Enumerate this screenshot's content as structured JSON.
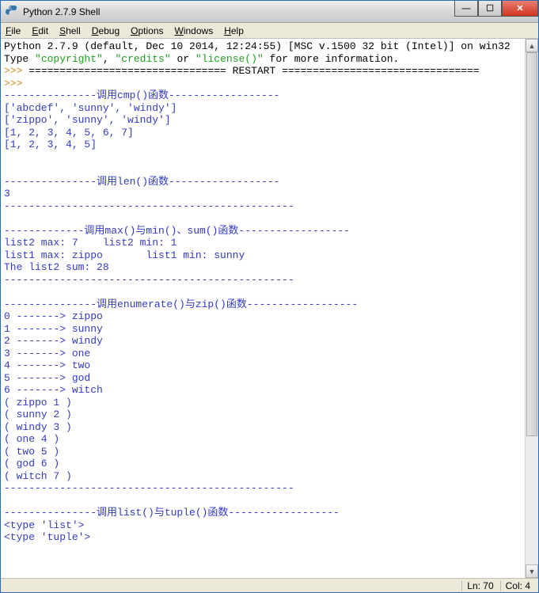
{
  "window": {
    "title": "Python 2.7.9 Shell"
  },
  "menu": {
    "file": "File",
    "edit": "Edit",
    "shell": "Shell",
    "debug": "Debug",
    "options": "Options",
    "windows": "Windows",
    "help": "Help"
  },
  "shell": {
    "version_line": "Python 2.7.9 (default, Dec 10 2014, 12:24:55) [MSC v.1500 32 bit (Intel)] on win32",
    "info_prefix": "Type ",
    "info_str1": "\"copyright\"",
    "info_sep1": ", ",
    "info_str2": "\"credits\"",
    "info_sep2": " or ",
    "info_str3": "\"license()\"",
    "info_suffix": " for more information.",
    "prompt1": ">>> ",
    "restart_line": "================================ RESTART ================================",
    "prompt2": ">>> ",
    "sec_cmp": "---------------调用cmp()函数------------------",
    "sec_cmp_l1": "['abcdef', 'sunny', 'windy']",
    "sec_cmp_l2": "['zippo', 'sunny', 'windy']",
    "sec_cmp_l3": "[1, 2, 3, 4, 5, 6, 7]",
    "sec_cmp_l4": "[1, 2, 3, 4, 5]",
    "blank": "",
    "sec_len": "---------------调用len()函数------------------",
    "sec_len_l1": "3",
    "sec_dash": "-----------------------------------------------",
    "sec_maxmin": "-------------调用max()与min()、sum()函数------------------",
    "sec_mm_l1": "list2 max: 7    list2 min: 1",
    "sec_mm_l2": "list1 max: zippo       list1 min: sunny",
    "sec_mm_l3": "The list2 sum: 28",
    "sec_enum": "---------------调用enumerate()与zip()函数------------------",
    "enum_0": "0 -------> zippo",
    "enum_1": "1 -------> sunny",
    "enum_2": "2 -------> windy",
    "enum_3": "3 -------> one",
    "enum_4": "4 -------> two",
    "enum_5": "5 -------> god",
    "enum_6": "6 -------> witch",
    "zip_0": "( zippo 1 )",
    "zip_1": "( sunny 2 )",
    "zip_2": "( windy 3 )",
    "zip_3": "( one 4 )",
    "zip_4": "( two 5 )",
    "zip_5": "( god 6 )",
    "zip_6": "( witch 7 )",
    "sec_list": "---------------调用list()与tuple()函数------------------",
    "type_list": "<type 'list'>",
    "type_tuple": "<type 'tuple'>"
  },
  "status": {
    "line": "Ln: 70",
    "col": "Col: 4"
  }
}
